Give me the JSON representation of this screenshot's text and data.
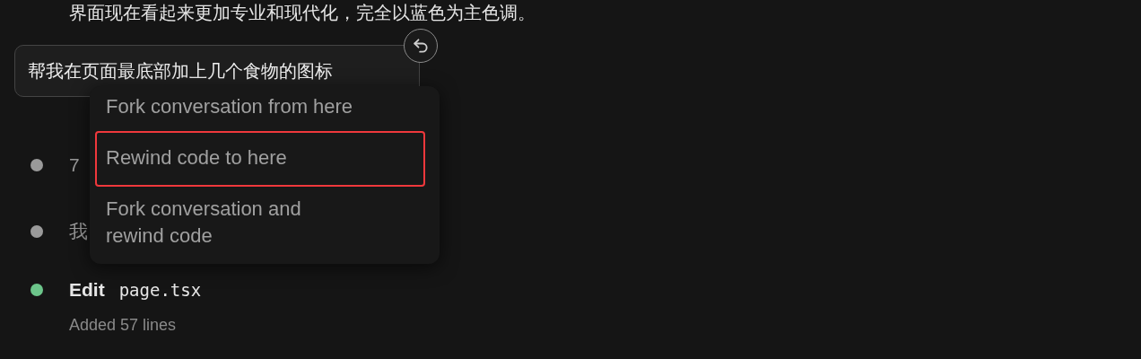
{
  "intro_text": "界面现在看起来更加专业和现代化，完全以蓝色为主色调。",
  "user_message": {
    "text": "帮我在页面最底部加上几个食物的图标"
  },
  "timeline": [
    {
      "kind": "text",
      "color": "#9a9a9a",
      "text": "7"
    },
    {
      "kind": "text",
      "color": "#9a9a9a",
      "text": "我"
    },
    {
      "kind": "tool",
      "color": "#6cc58a",
      "action": "Edit",
      "file": "page.tsx",
      "detail": "Added 57 lines"
    }
  ],
  "menu": {
    "items": [
      {
        "label": "Fork conversation from here",
        "selected": false
      },
      {
        "label": "Rewind code to here",
        "selected": true
      },
      {
        "label": "Fork conversation and rewind code",
        "selected": false
      }
    ]
  }
}
